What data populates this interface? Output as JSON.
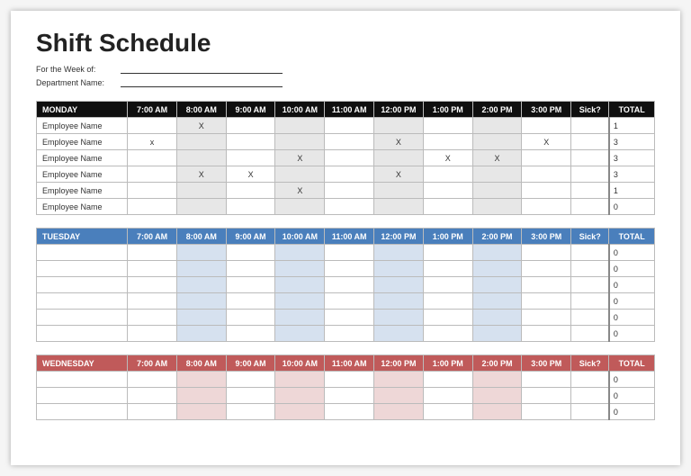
{
  "title": "Shift Schedule",
  "meta": {
    "week_label": "For the Week of:",
    "week_value": "",
    "dept_label": "Department Name:",
    "dept_value": ""
  },
  "time_headers": [
    "7:00 AM",
    "8:00 AM",
    "9:00 AM",
    "10:00 AM",
    "11:00 AM",
    "12:00 PM",
    "1:00 PM",
    "2:00 PM",
    "3:00 PM"
  ],
  "sick_header": "Sick?",
  "total_header": "TOTAL",
  "days": [
    {
      "label": "MONDAY",
      "theme": "mon",
      "rows": [
        {
          "emp": "Employee Name",
          "cells": [
            "",
            "X",
            "",
            "",
            "",
            "",
            "",
            "",
            "",
            ""
          ],
          "total": "1"
        },
        {
          "emp": "Employee Name",
          "cells": [
            "x",
            "",
            "",
            "",
            "",
            "X",
            "",
            "",
            "X",
            ""
          ],
          "total": "3"
        },
        {
          "emp": "Employee Name",
          "cells": [
            "",
            "",
            "",
            "X",
            "",
            "",
            "X",
            "X",
            "",
            ""
          ],
          "total": "3"
        },
        {
          "emp": "Employee Name",
          "cells": [
            "",
            "X",
            "X",
            "",
            "",
            "X",
            "",
            "",
            "",
            ""
          ],
          "total": "3"
        },
        {
          "emp": "Employee Name",
          "cells": [
            "",
            "",
            "",
            "X",
            "",
            "",
            "",
            "",
            "",
            ""
          ],
          "total": "1"
        },
        {
          "emp": "Employee Name",
          "cells": [
            "",
            "",
            "",
            "",
            "",
            "",
            "",
            "",
            "",
            ""
          ],
          "total": "0"
        }
      ]
    },
    {
      "label": "TUESDAY",
      "theme": "tue",
      "rows": [
        {
          "emp": "",
          "cells": [
            "",
            "",
            "",
            "",
            "",
            "",
            "",
            "",
            "",
            ""
          ],
          "total": "0"
        },
        {
          "emp": "",
          "cells": [
            "",
            "",
            "",
            "",
            "",
            "",
            "",
            "",
            "",
            ""
          ],
          "total": "0"
        },
        {
          "emp": "",
          "cells": [
            "",
            "",
            "",
            "",
            "",
            "",
            "",
            "",
            "",
            ""
          ],
          "total": "0"
        },
        {
          "emp": "",
          "cells": [
            "",
            "",
            "",
            "",
            "",
            "",
            "",
            "",
            "",
            ""
          ],
          "total": "0"
        },
        {
          "emp": "",
          "cells": [
            "",
            "",
            "",
            "",
            "",
            "",
            "",
            "",
            "",
            ""
          ],
          "total": "0"
        },
        {
          "emp": "",
          "cells": [
            "",
            "",
            "",
            "",
            "",
            "",
            "",
            "",
            "",
            ""
          ],
          "total": "0"
        }
      ]
    },
    {
      "label": "WEDNESDAY",
      "theme": "wed",
      "rows": [
        {
          "emp": "",
          "cells": [
            "",
            "",
            "",
            "",
            "",
            "",
            "",
            "",
            "",
            ""
          ],
          "total": "0"
        },
        {
          "emp": "",
          "cells": [
            "",
            "",
            "",
            "",
            "",
            "",
            "",
            "",
            "",
            ""
          ],
          "total": "0"
        },
        {
          "emp": "",
          "cells": [
            "",
            "",
            "",
            "",
            "",
            "",
            "",
            "",
            "",
            ""
          ],
          "total": "0"
        }
      ]
    }
  ]
}
